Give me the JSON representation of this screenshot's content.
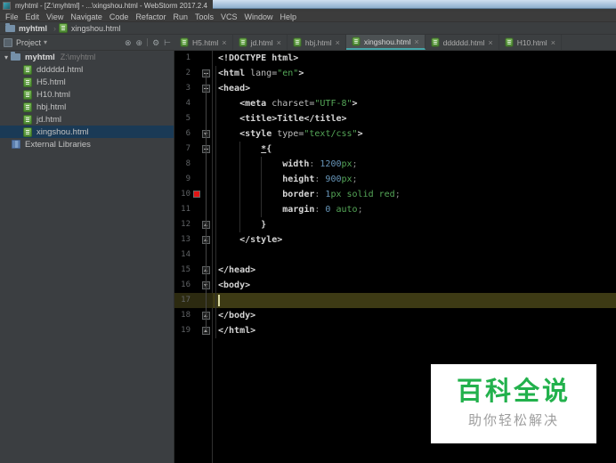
{
  "window": {
    "title": "myhtml - [Z:\\myhtml] - ...\\xingshou.html - WebStorm 2017.2.4"
  },
  "menubar": {
    "items": [
      "File",
      "Edit",
      "View",
      "Navigate",
      "Code",
      "Refactor",
      "Run",
      "Tools",
      "VCS",
      "Window",
      "Help"
    ]
  },
  "navbar": {
    "crumbs": [
      {
        "label": "myhtml",
        "type": "folder"
      },
      {
        "label": "xingshou.html",
        "type": "html"
      }
    ]
  },
  "project_panel": {
    "header": {
      "title": "Project",
      "caret_glyph": "▾",
      "icons": [
        {
          "name": "collapse-all-icon",
          "glyph": "⊗"
        },
        {
          "name": "locate-icon",
          "glyph": "⊕"
        },
        {
          "name": "settings-icon",
          "glyph": "⚙"
        },
        {
          "name": "hide-panel-icon",
          "glyph": "⊢"
        }
      ]
    },
    "tree": [
      {
        "label": "myhtml",
        "path": "Z:\\myhtml",
        "type": "root",
        "expanded": true
      },
      {
        "label": "dddddd.html",
        "type": "file"
      },
      {
        "label": "H5.html",
        "type": "file"
      },
      {
        "label": "H10.html",
        "type": "file"
      },
      {
        "label": "hbj.html",
        "type": "file"
      },
      {
        "label": "jd.html",
        "type": "file"
      },
      {
        "label": "xingshou.html",
        "type": "file",
        "selected": true
      },
      {
        "label": "External Libraries",
        "type": "lib"
      }
    ]
  },
  "tabbar": {
    "close_glyph": "×",
    "tabs": [
      {
        "label": "H5.html"
      },
      {
        "label": "jd.html"
      },
      {
        "label": "hbj.html"
      },
      {
        "label": "xingshou.html",
        "active": true
      },
      {
        "label": "dddddd.html"
      },
      {
        "label": "H10.html"
      }
    ]
  },
  "editor": {
    "lines": [
      {
        "n": 1,
        "tokens": [
          [
            "tag",
            "<!DOCTYPE html>"
          ]
        ]
      },
      {
        "n": 2,
        "fold": "minus",
        "tokens": [
          [
            "tag",
            "<html "
          ],
          [
            "attr",
            "lang="
          ],
          [
            "str",
            "\"en\""
          ],
          [
            "tag",
            ">"
          ]
        ]
      },
      {
        "n": 3,
        "fold": "minus",
        "tokens": [
          [
            "tag",
            "<head>"
          ]
        ]
      },
      {
        "n": 4,
        "tokens": [
          [
            "plain",
            "    "
          ],
          [
            "tag",
            "<meta "
          ],
          [
            "attr",
            "charset="
          ],
          [
            "str",
            "\"UTF-8\""
          ],
          [
            "tag",
            ">"
          ]
        ]
      },
      {
        "n": 5,
        "tokens": [
          [
            "plain",
            "    "
          ],
          [
            "tag",
            "<title>"
          ],
          [
            "text",
            "Title"
          ],
          [
            "tag",
            "</title>"
          ]
        ]
      },
      {
        "n": 6,
        "fold": "down",
        "tokens": [
          [
            "plain",
            "    "
          ],
          [
            "tag",
            "<style "
          ],
          [
            "attr",
            "type="
          ],
          [
            "str",
            "\"text/css\""
          ],
          [
            "tag",
            ">"
          ]
        ]
      },
      {
        "n": 7,
        "fold": "minus",
        "tokens": [
          [
            "plain",
            "        "
          ],
          [
            "sel",
            "*"
          ],
          [
            "text",
            "{"
          ]
        ]
      },
      {
        "n": 8,
        "tokens": [
          [
            "plain",
            "            "
          ],
          [
            "prop",
            "width"
          ],
          [
            "punc",
            ": "
          ],
          [
            "num",
            "1200"
          ],
          [
            "kw",
            "px"
          ],
          [
            "punc",
            ";"
          ]
        ]
      },
      {
        "n": 9,
        "tokens": [
          [
            "plain",
            "            "
          ],
          [
            "prop",
            "height"
          ],
          [
            "punc",
            ": "
          ],
          [
            "num",
            "900"
          ],
          [
            "kw",
            "px"
          ],
          [
            "punc",
            ";"
          ]
        ]
      },
      {
        "n": 10,
        "swatch": true,
        "tokens": [
          [
            "plain",
            "            "
          ],
          [
            "prop",
            "border"
          ],
          [
            "punc",
            ": "
          ],
          [
            "num",
            "1"
          ],
          [
            "kw",
            "px solid red"
          ],
          [
            "punc",
            ";"
          ]
        ]
      },
      {
        "n": 11,
        "tokens": [
          [
            "plain",
            "            "
          ],
          [
            "prop",
            "margin"
          ],
          [
            "punc",
            ": "
          ],
          [
            "num",
            "0"
          ],
          [
            "kw",
            " auto"
          ],
          [
            "punc",
            ";"
          ]
        ]
      },
      {
        "n": 12,
        "fold": "up",
        "tokens": [
          [
            "plain",
            "        "
          ],
          [
            "text",
            "}"
          ]
        ]
      },
      {
        "n": 13,
        "fold": "up",
        "tokens": [
          [
            "plain",
            "    "
          ],
          [
            "tag",
            "</style>"
          ]
        ]
      },
      {
        "n": 14,
        "tokens": []
      },
      {
        "n": 15,
        "fold": "up",
        "tokens": [
          [
            "tag",
            "</head>"
          ]
        ]
      },
      {
        "n": 16,
        "fold": "down",
        "tokens": [
          [
            "tag",
            "<body>"
          ]
        ]
      },
      {
        "n": 17,
        "current": true,
        "tokens": []
      },
      {
        "n": 18,
        "fold": "up",
        "tokens": [
          [
            "tag",
            "</body>"
          ]
        ]
      },
      {
        "n": 19,
        "fold": "up",
        "tokens": [
          [
            "tag",
            "</html>"
          ]
        ]
      }
    ]
  },
  "watermark": {
    "title": "百科全说",
    "subtitle": "助你轻松解决"
  },
  "colors": {
    "accent_green": "#22b14c",
    "string_green": "#55a758",
    "number_blue": "#6897bb",
    "tab_underline": "#45a5a8",
    "swatch_red": "#e01414",
    "current_line": "#3d3a14",
    "selected_row": "#1a3a56"
  }
}
